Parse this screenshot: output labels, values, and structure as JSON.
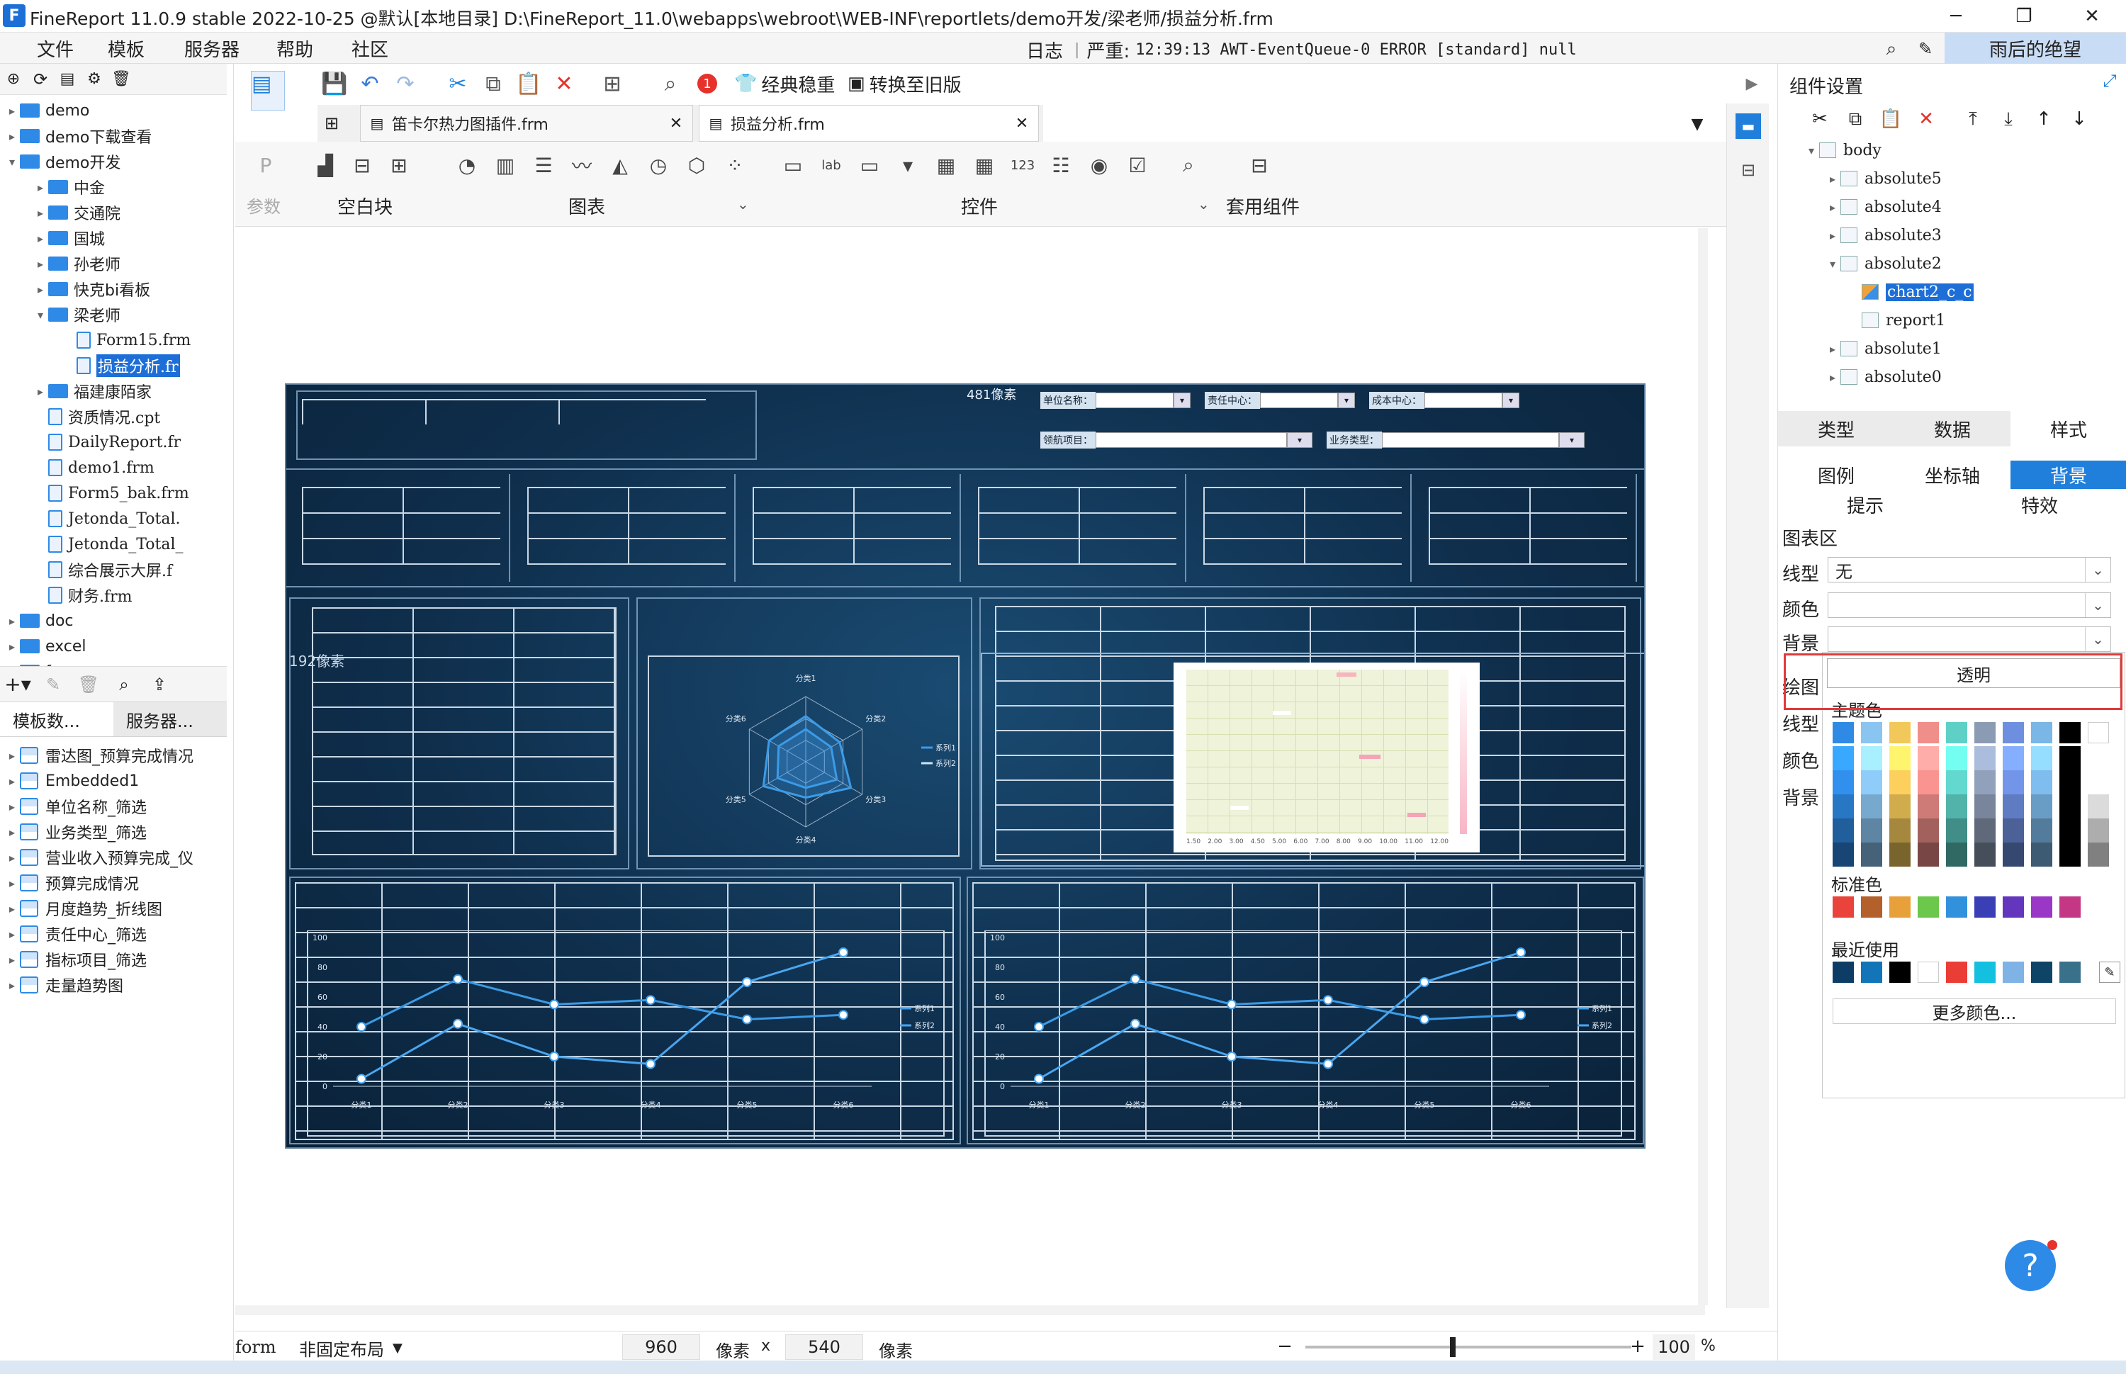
{
  "title_bar": {
    "text": "FineReport 11.0.9 stable 2022-10-25 @默认[本地目录]    D:\\FineReport_11.0\\webapps\\webroot\\WEB-INF\\reportlets/demo开发/梁老师/损益分析.frm"
  },
  "menu": [
    "文件",
    "模板",
    "服务器",
    "帮助",
    "社区"
  ],
  "log": {
    "label": "日志",
    "level": "严重:",
    "message": "12:39:13 AWT-EventQueue-0 ERROR [standard] null"
  },
  "user": "雨后的绝望",
  "file_tree": [
    {
      "label": "demo",
      "type": "folder",
      "depth": 0,
      "open": false
    },
    {
      "label": "demo下载查看",
      "type": "folder",
      "depth": 0,
      "open": false
    },
    {
      "label": "demo开发",
      "type": "folder",
      "depth": 0,
      "open": true
    },
    {
      "label": "中金",
      "type": "folder",
      "depth": 1,
      "open": false
    },
    {
      "label": "交通院",
      "type": "folder",
      "depth": 1,
      "open": false
    },
    {
      "label": "国城",
      "type": "folder",
      "depth": 1,
      "open": false
    },
    {
      "label": "孙老师",
      "type": "folder",
      "depth": 1,
      "open": false
    },
    {
      "label": "快克bi看板",
      "type": "folder",
      "depth": 1,
      "open": false
    },
    {
      "label": "梁老师",
      "type": "folder",
      "depth": 1,
      "open": true
    },
    {
      "label": "Form15.frm",
      "type": "file",
      "depth": 2
    },
    {
      "label": "损益分析.fr",
      "type": "file",
      "depth": 2,
      "selected": true
    },
    {
      "label": "福建康陌家",
      "type": "folder",
      "depth": 1,
      "open": false
    },
    {
      "label": "资质情况.cpt",
      "type": "file",
      "depth": 1
    },
    {
      "label": "DailyReport.fr",
      "type": "file",
      "depth": 1
    },
    {
      "label": "demo1.frm",
      "type": "file",
      "depth": 1
    },
    {
      "label": "Form5_bak.frm",
      "type": "file",
      "depth": 1
    },
    {
      "label": "Jetonda_Total.",
      "type": "file",
      "depth": 1
    },
    {
      "label": "Jetonda_Total_",
      "type": "file",
      "depth": 1
    },
    {
      "label": "综合展示大屏.f",
      "type": "file",
      "depth": 1
    },
    {
      "label": "财务.frm",
      "type": "file",
      "depth": 1
    },
    {
      "label": "doc",
      "type": "folder",
      "depth": 0,
      "open": false
    },
    {
      "label": "excel",
      "type": "folder",
      "depth": 0,
      "open": false
    },
    {
      "label": "fvs",
      "type": "folder",
      "depth": 0,
      "open": false
    }
  ],
  "bottom_tabs": [
    "模板数...",
    "服务器..."
  ],
  "datasets": [
    "雷达图_预算完成情况",
    "Embedded1",
    "单位名称_筛选",
    "业务类型_筛选",
    "营业收入预算完成_仪",
    "预算完成情况",
    "月度趋势_折线图",
    "责任中心_筛选",
    "指标项目_筛选",
    "走量趋势图"
  ],
  "toolbar": {
    "badge": "1",
    "classic_btn": "经典稳重",
    "convert_btn": "转换至旧版"
  },
  "doc_tabs": [
    {
      "label": "笛卡尔热力图插件.frm"
    },
    {
      "label": "损益分析.frm"
    }
  ],
  "widget_bar": {
    "param": "参数",
    "blank": "空白块",
    "chart": "图表",
    "control": "控件",
    "reuse": "套用组件"
  },
  "dashboard": {
    "size_label_1": "481像素",
    "size_label_2": "192像素",
    "filters": [
      "单位名称：",
      "责任中心：",
      "成本中心：",
      "领航项目：",
      "业务类型："
    ],
    "radar": {
      "axes": [
        "分类1",
        "分类2",
        "分类3",
        "分类4",
        "分类5",
        "分类6"
      ],
      "legend": [
        "系列1",
        "系列2"
      ]
    },
    "heatmap_x": [
      "1.50",
      "2.00",
      "3.00",
      "4.50",
      "5.00",
      "6.00",
      "7.00",
      "8.00",
      "9.00",
      "10.00",
      "11.00",
      "12.00"
    ]
  },
  "chart_data": [
    {
      "type": "line",
      "categories": [
        "分类1",
        "分类2",
        "分类3",
        "分类4",
        "分类5",
        "分类6"
      ],
      "ylim": [
        0,
        100
      ],
      "yticks": [
        0,
        20,
        40,
        60,
        80,
        100
      ],
      "series": [
        {
          "name": "系列1",
          "values": [
            40,
            72,
            55,
            58,
            45,
            48
          ]
        },
        {
          "name": "系列2",
          "values": [
            5,
            42,
            20,
            15,
            70,
            90
          ]
        }
      ],
      "legend": "right"
    },
    {
      "type": "line",
      "categories": [
        "分类1",
        "分类2",
        "分类3",
        "分类4",
        "分类5",
        "分类6"
      ],
      "ylim": [
        0,
        100
      ],
      "yticks": [
        0,
        20,
        40,
        60,
        80,
        100
      ],
      "series": [
        {
          "name": "系列1",
          "values": [
            40,
            72,
            55,
            58,
            45,
            48
          ]
        },
        {
          "name": "系列2",
          "values": [
            5,
            42,
            20,
            15,
            70,
            90
          ]
        }
      ],
      "legend": "right"
    }
  ],
  "inspector": {
    "title": "组件设置",
    "tree": [
      {
        "label": "body",
        "depth": 0,
        "open": true
      },
      {
        "label": "absolute5",
        "depth": 1
      },
      {
        "label": "absolute4",
        "depth": 1
      },
      {
        "label": "absolute3",
        "depth": 1
      },
      {
        "label": "absolute2",
        "depth": 1,
        "open": true
      },
      {
        "label": "chart2_c_c",
        "depth": 2,
        "selected": true
      },
      {
        "label": "report1",
        "depth": 2
      },
      {
        "label": "absolute1",
        "depth": 1
      },
      {
        "label": "absolute0",
        "depth": 1
      }
    ],
    "main_tabs": [
      "类型",
      "数据",
      "样式"
    ],
    "sub_tabs": [
      "图例",
      "坐标轴",
      "背景"
    ],
    "sub_tabs2": [
      "提示",
      "特效"
    ],
    "section": "图表区",
    "line_type_label": "线型",
    "line_type_value": "无",
    "color_label": "颜色",
    "bg_label": "背景",
    "plot_label": "绘图",
    "transparent": "透明",
    "theme_colors_label": "主题色",
    "standard_colors_label": "标准色",
    "recent_label": "最近使用",
    "more_colors": "更多颜色..."
  },
  "colors": {
    "theme_row": [
      "#2f8ae5",
      "#8ac4f0",
      "#f3c85a",
      "#f08e8a",
      "#5fd0c6",
      "#8c9bb4",
      "#6e8fe0",
      "#7ab6e6",
      "#000000",
      "#ffffff"
    ],
    "standard_row": [
      "#e9433b",
      "#b4602b",
      "#e8a13a",
      "#6bc84a",
      "#3191dd",
      "#3a3fb5",
      "#6436bd",
      "#9a37c7",
      "#c33784"
    ],
    "recent_row": [
      "#0d3d66",
      "#1275b8",
      "#000000",
      "#ffffff",
      "#ea3d35",
      "#14c0df",
      "#7fb2e5",
      "#0e4567",
      "#39708a"
    ],
    "accent": "#1f7fdb"
  },
  "status": {
    "mode": "form",
    "layout": "非固定布局",
    "width": "960",
    "width_unit": "像素",
    "x": "x",
    "height": "540",
    "height_unit": "像素",
    "zoom": "100",
    "zoom_unit": "%"
  }
}
